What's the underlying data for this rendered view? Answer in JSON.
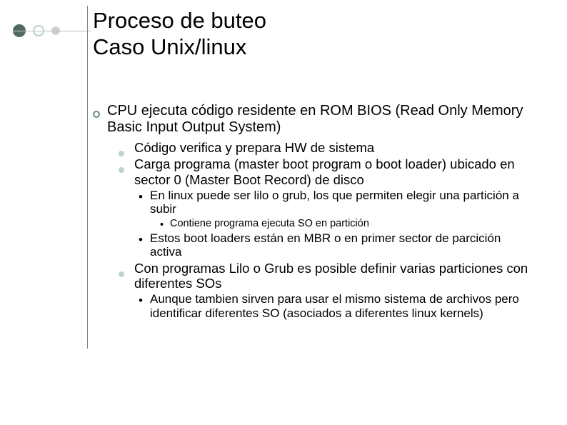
{
  "title_line1": "Proceso de buteo",
  "title_line2": "Caso Unix/linux",
  "lvl1_1": "CPU ejecuta código residente en ROM BIOS (Read Only Memory Basic Input Output System)",
  "lvl2_1": "Código verifica y prepara HW de sistema",
  "lvl2_2": "Carga programa (master boot program o boot loader) ubicado en sector 0 (Master Boot Record) de disco",
  "lvl3_1": "En linux puede ser lilo o grub, los que permiten elegir una partición a subir",
  "lvl4_1": "Contiene programa ejecuta SO en partición",
  "lvl3_2": "Estos boot loaders están en MBR o en primer sector de parcición activa",
  "lvl2_3": "Con programas Lilo o Grub es posible definir varias particiones con diferentes SOs",
  "lvl3_3": "Aunque tambien sirven para usar el mismo sistema de archivos pero identificar diferentes SO (asociados a diferentes linux kernels)"
}
